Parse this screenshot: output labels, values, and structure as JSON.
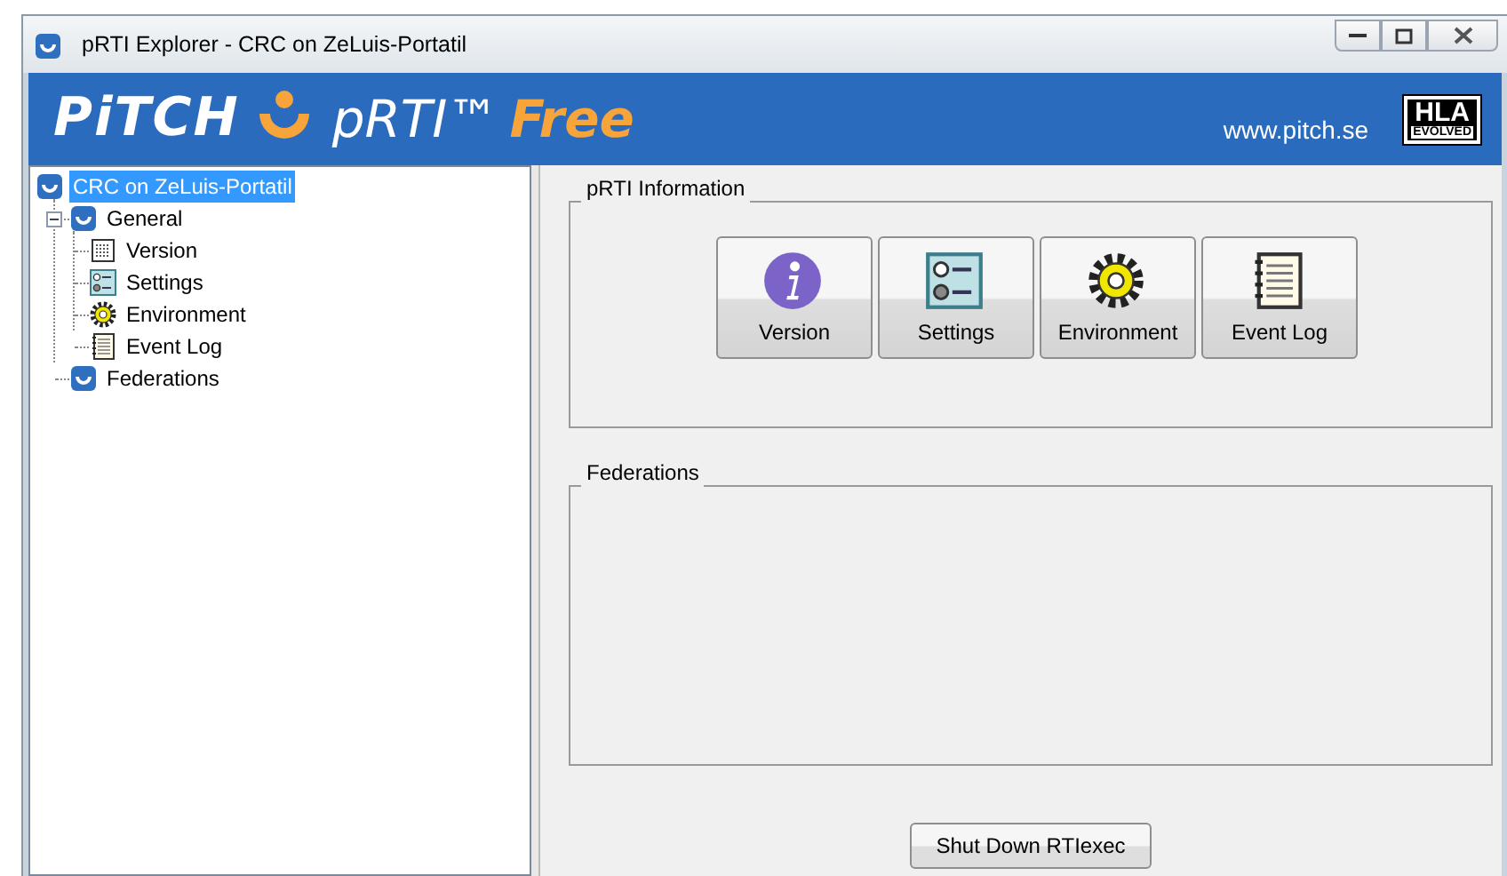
{
  "window": {
    "title": "pRTI Explorer - CRC on ZeLuis-Portatil"
  },
  "banner": {
    "logo": "PiTCH",
    "product": "pRTI™",
    "edition": "Free",
    "url": "www.pitch.se",
    "badge_top": "HLA",
    "badge_bottom": "EVOLVED"
  },
  "tree": [
    {
      "label": "CRC on ZeLuis-Portatil",
      "kind": "server",
      "selected": true,
      "children": [
        {
          "label": "General",
          "kind": "server",
          "selected": false,
          "expanded": true,
          "children": [
            {
              "label": "Version",
              "kind": "version",
              "selected": false
            },
            {
              "label": "Settings",
              "kind": "settings",
              "selected": false
            },
            {
              "label": "Environment",
              "kind": "gear",
              "selected": false
            },
            {
              "label": "Event Log",
              "kind": "log",
              "selected": false
            }
          ]
        },
        {
          "label": "Federations",
          "kind": "server",
          "selected": false
        }
      ]
    }
  ],
  "info_group": {
    "title": "pRTI Information",
    "buttons": [
      {
        "label": "Version",
        "kind": "info"
      },
      {
        "label": "Settings",
        "kind": "settings"
      },
      {
        "label": "Environment",
        "kind": "gear"
      },
      {
        "label": "Event Log",
        "kind": "log"
      }
    ]
  },
  "federations_group": {
    "title": "Federations"
  },
  "shutdown_button": "Shut Down RTIexec"
}
